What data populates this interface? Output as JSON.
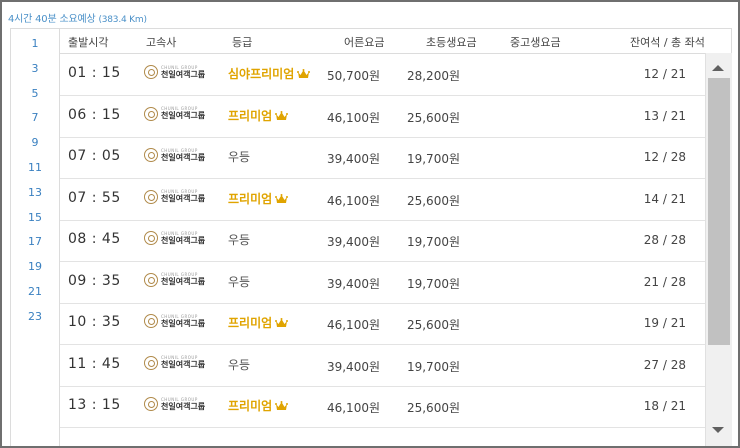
{
  "summary": {
    "duration": "4시간 40분 소요예상",
    "distance": "(383.4 Km)"
  },
  "page_numbers": [
    "1",
    "3",
    "5",
    "7",
    "9",
    "11",
    "13",
    "15",
    "17",
    "19",
    "21",
    "23"
  ],
  "headers": {
    "departure": "출발시각",
    "company": "고속사",
    "grade": "등급",
    "adult": "어른요금",
    "child": "초등생요금",
    "youth": "중고생요금",
    "seats": "잔여석 / 총 좌석"
  },
  "company_logo": {
    "en": "CHUNIL GROUP",
    "ko": "천일여객그룹"
  },
  "colors": {
    "accent": "#4a90c8",
    "premium": "#e0a400"
  },
  "rows": [
    {
      "time": "01 : 15",
      "grade": "심야프리미엄",
      "premium": true,
      "adult": "50,700원",
      "child": "28,200원",
      "youth": "",
      "seats": "12 / 21"
    },
    {
      "time": "06 : 15",
      "grade": "프리미엄",
      "premium": true,
      "adult": "46,100원",
      "child": "25,600원",
      "youth": "",
      "seats": "13 / 21"
    },
    {
      "time": "07 : 05",
      "grade": "우등",
      "premium": false,
      "adult": "39,400원",
      "child": "19,700원",
      "youth": "",
      "seats": "12 / 28"
    },
    {
      "time": "07 : 55",
      "grade": "프리미엄",
      "premium": true,
      "adult": "46,100원",
      "child": "25,600원",
      "youth": "",
      "seats": "14 / 21"
    },
    {
      "time": "08 : 45",
      "grade": "우등",
      "premium": false,
      "adult": "39,400원",
      "child": "19,700원",
      "youth": "",
      "seats": "28 / 28"
    },
    {
      "time": "09 : 35",
      "grade": "우등",
      "premium": false,
      "adult": "39,400원",
      "child": "19,700원",
      "youth": "",
      "seats": "21 / 28"
    },
    {
      "time": "10 : 35",
      "grade": "프리미엄",
      "premium": true,
      "adult": "46,100원",
      "child": "25,600원",
      "youth": "",
      "seats": "19 / 21"
    },
    {
      "time": "11 : 45",
      "grade": "우등",
      "premium": false,
      "adult": "39,400원",
      "child": "19,700원",
      "youth": "",
      "seats": "27 / 28"
    },
    {
      "time": "13 : 15",
      "grade": "프리미엄",
      "premium": true,
      "adult": "46,100원",
      "child": "25,600원",
      "youth": "",
      "seats": "18 / 21"
    },
    {
      "time": "",
      "grade": "",
      "premium": false,
      "adult": "",
      "child": "",
      "youth": "",
      "seats": ""
    }
  ]
}
